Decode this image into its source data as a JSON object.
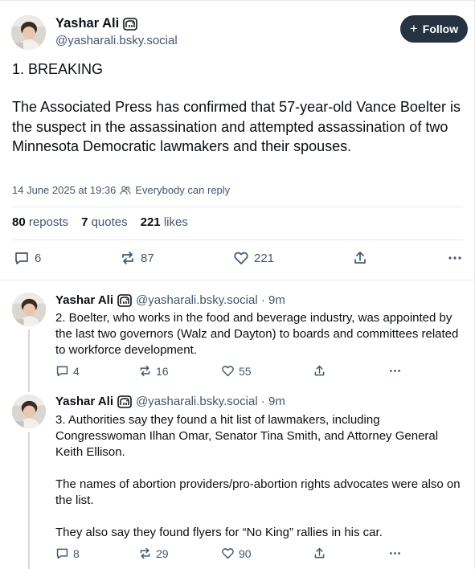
{
  "post": {
    "author_name": "Yashar Ali",
    "author_handle": "@yasharali.bsky.social",
    "follow_label": "Follow",
    "text_line1": "1. BREAKING",
    "text_body": "The Associated Press has confirmed that 57-year-old Vance Boelter is the suspect in the assassination and attempted assassination of two Minnesota Democratic lawmakers and their spouses.",
    "timestamp": "14 June 2025 at 19:36",
    "reply_setting": "Everybody can reply",
    "stats": {
      "reposts_count": "80",
      "reposts_label": "reposts",
      "quotes_count": "7",
      "quotes_label": "quotes",
      "likes_count": "221",
      "likes_label": "likes"
    },
    "actions": {
      "replies": "6",
      "reposts": "87",
      "likes": "221"
    }
  },
  "replies": [
    {
      "author_name": "Yashar Ali",
      "author_handle": "@yasharali.bsky.social · 9m",
      "paragraphs": [
        "2. Boelter, who works in the food and beverage industry, was appointed by the last two governors (Walz and Dayton) to boards and committees related to workforce development."
      ],
      "replies": "4",
      "reposts": "16",
      "likes": "55"
    },
    {
      "author_name": "Yashar Ali",
      "author_handle": "@yasharali.bsky.social · 9m",
      "paragraphs": [
        "3. Authorities say they found a hit list of lawmakers, including Congresswoman Ilhan Omar, Senator Tina Smith, and Attorney General Keith Ellison.",
        "The names of abortion providers/pro-abortion rights advocates were also on the list.",
        "They also say they found flyers for “No King” rallies in his car."
      ],
      "replies": "8",
      "reposts": "29",
      "likes": "90"
    }
  ],
  "icons": {
    "badge": "elephant-icon",
    "reply": "reply-bubble-icon",
    "repost": "repost-arrows-icon",
    "like": "heart-icon",
    "share": "share-icon",
    "more": "more-dots-icon",
    "people": "people-icon"
  },
  "colors": {
    "text": "#0b0f14",
    "muted": "#42576c",
    "follow_bg": "#263340",
    "border": "#e6e8ea"
  }
}
